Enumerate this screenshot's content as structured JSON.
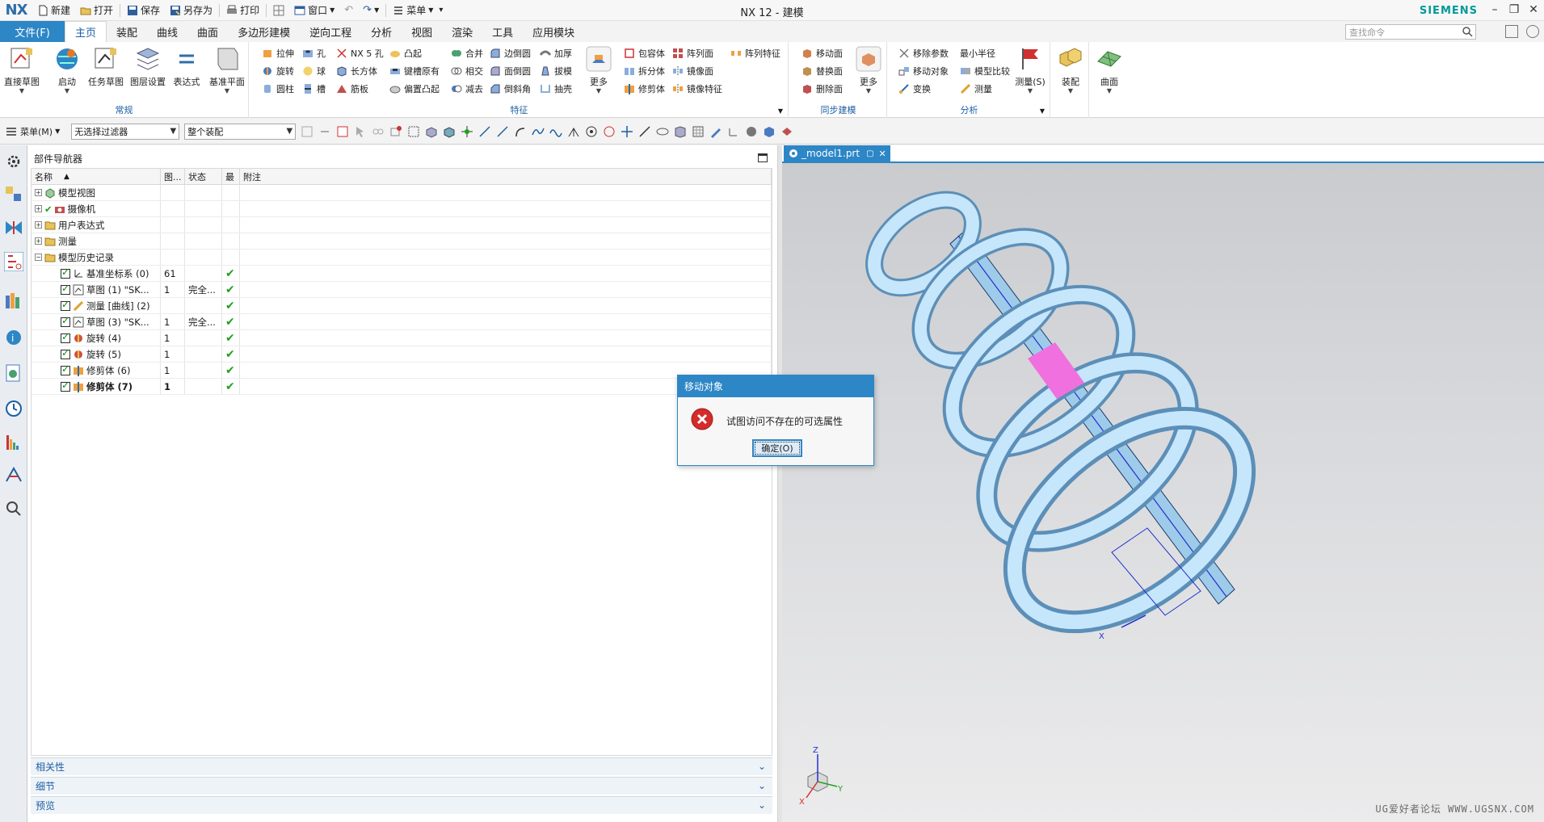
{
  "window": {
    "logo": "NX",
    "title": "NX 12 - 建模",
    "brand": "SIEMENS"
  },
  "quick_access": {
    "new": "新建",
    "open": "打开",
    "save": "保存",
    "save_as": "另存为",
    "print": "打印",
    "window": "窗口",
    "menu": "菜单"
  },
  "tabs": {
    "file": "文件(F)",
    "items": [
      "主页",
      "装配",
      "曲线",
      "曲面",
      "多边形建模",
      "逆向工程",
      "分析",
      "视图",
      "渲染",
      "工具",
      "应用模块"
    ],
    "search_placeholder": "查找命令"
  },
  "ribbon": {
    "common": {
      "label": "常规",
      "buttons": [
        "直接草图",
        "启动",
        "任务草图",
        "图层设置",
        "表达式",
        "基准平面"
      ]
    },
    "feature": {
      "label": "特征",
      "col1": [
        "拉伸",
        "旋转",
        "圆柱"
      ],
      "col2": [
        "孔",
        "球",
        "槽"
      ],
      "col3": [
        "NX 5 孔",
        "长方体",
        "筋板"
      ],
      "col4": [
        "凸起",
        "键槽原有",
        "偏置凸起"
      ],
      "col5": [
        "合并",
        "相交",
        "减去"
      ],
      "col6": [
        "边倒圆",
        "面倒圆",
        "倒斜角"
      ],
      "col7": [
        "加厚",
        "拔模",
        "抽壳"
      ],
      "more": "更多",
      "col8": [
        "包容体",
        "拆分体",
        "修剪体"
      ],
      "col9": [
        "阵列面",
        "镜像面",
        "镜像特征"
      ],
      "col10": [
        "阵列特征"
      ]
    },
    "sync": {
      "label": "同步建模",
      "col1": [
        "移动面",
        "替换面",
        "删除面"
      ],
      "more": "更多"
    },
    "analysis": {
      "label": "分析",
      "col1": [
        "移除参数",
        "移动对象",
        "变换"
      ],
      "col2": [
        "最小半径",
        "模型比较",
        "测量"
      ],
      "measure_big": "测量(S)"
    },
    "assembly": "装配",
    "surface": "曲面"
  },
  "selection_bar": {
    "menu": "菜单(M)",
    "filter": "无选择过滤器",
    "scope": "整个装配"
  },
  "navigator": {
    "title": "部件导航器",
    "columns": [
      "名称",
      "图...",
      "状态",
      "最",
      "附注"
    ],
    "top_nodes": [
      "模型视图",
      "摄像机",
      "用户表达式",
      "测量",
      "模型历史记录"
    ],
    "history": [
      {
        "name": "基准坐标系 (0)",
        "pic": "61",
        "status": "",
        "latest": true
      },
      {
        "name": "草图 (1) \"SK...",
        "pic": "1",
        "status": "完全...",
        "latest": true
      },
      {
        "name": "测量 [曲线] (2)",
        "pic": "",
        "status": "",
        "latest": true
      },
      {
        "name": "草图 (3) \"SK...",
        "pic": "1",
        "status": "完全...",
        "latest": true
      },
      {
        "name": "旋转 (4)",
        "pic": "1",
        "status": "",
        "latest": true
      },
      {
        "name": "旋转 (5)",
        "pic": "1",
        "status": "",
        "latest": true
      },
      {
        "name": "修剪体 (6)",
        "pic": "1",
        "status": "",
        "latest": true
      },
      {
        "name": "修剪体 (7)",
        "pic": "1",
        "status": "",
        "latest": true
      }
    ],
    "panels": [
      "相关性",
      "细节",
      "预览"
    ]
  },
  "graphics": {
    "doc_tab": "_model1.prt",
    "watermark": "UG爱好者论坛  WWW.UGSNX.COM",
    "triad": {
      "x": "X",
      "y": "Y",
      "z": "Z"
    },
    "csys_label": "X"
  },
  "dialog": {
    "title": "移动对象",
    "message": "试图访问不存在的可选属性",
    "ok": "确定(O)"
  }
}
